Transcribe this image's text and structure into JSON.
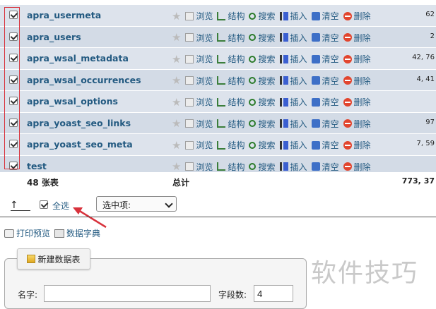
{
  "tables": [
    {
      "name": "apra_usermeta",
      "rows": "62",
      "checked": true
    },
    {
      "name": "apra_users",
      "rows": "2",
      "checked": true
    },
    {
      "name": "apra_wsal_metadata",
      "rows": "42, 76",
      "checked": true
    },
    {
      "name": "apra_wsal_occurrences",
      "rows": "4, 41",
      "checked": true
    },
    {
      "name": "apra_wsal_options",
      "rows": "",
      "checked": true
    },
    {
      "name": "apra_yoast_seo_links",
      "rows": "97",
      "checked": true
    },
    {
      "name": "apra_yoast_seo_meta",
      "rows": "7, 59",
      "checked": true
    },
    {
      "name": "test",
      "rows": "",
      "checked": true
    }
  ],
  "actions": {
    "browse": "浏览",
    "structure": "结构",
    "search": "搜索",
    "insert": "插入",
    "empty": "清空",
    "drop": "删除"
  },
  "summary": {
    "table_count": "48 张表",
    "total_label": "总计",
    "total_size": "773, 37"
  },
  "bulk": {
    "select_all": "全选",
    "with_selected": "选中项:"
  },
  "links": {
    "print_preview": "打印预览",
    "data_dictionary": "数据字典"
  },
  "create_table": {
    "button": "新建数据表",
    "name_label": "名字:",
    "name_value": "",
    "columns_label": "字段数:",
    "columns_value": "4"
  },
  "watermark": "软件技巧",
  "colors": {
    "row_bg": "#dde3ec",
    "row_alt_bg": "#d3dbe6",
    "link": "#235a81",
    "highlight_red": "#d8323c"
  }
}
